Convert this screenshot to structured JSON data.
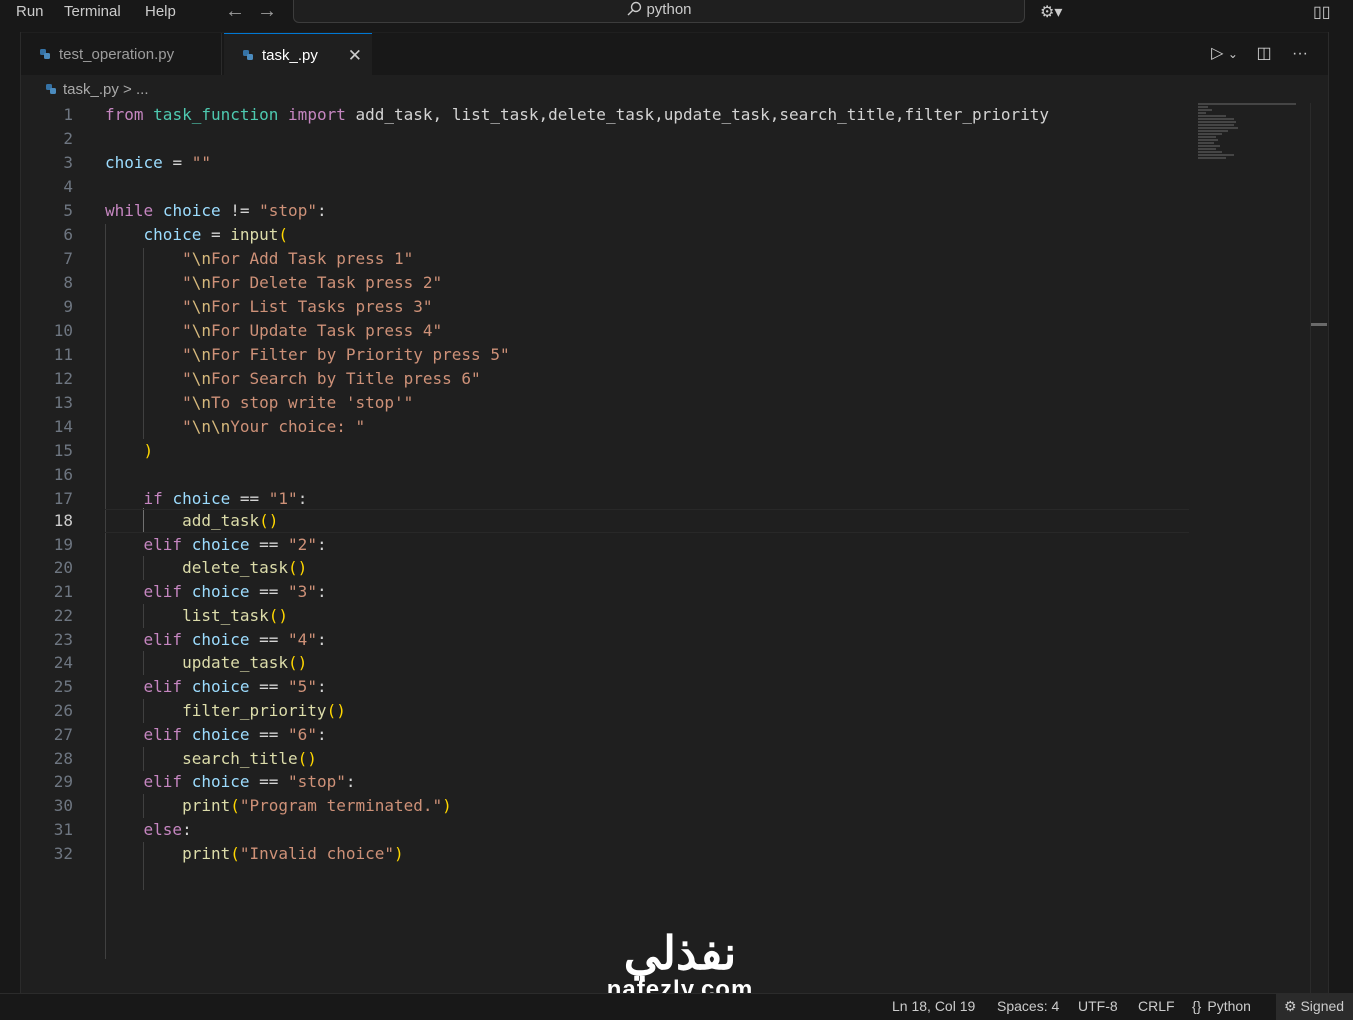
{
  "menu": {
    "run": "Run",
    "terminal": "Terminal",
    "help": "Help"
  },
  "search": {
    "text": "python"
  },
  "tabs": [
    {
      "label": "test_operation.py"
    },
    {
      "label": "task_.py",
      "close": "✕"
    }
  ],
  "breadcrumb": {
    "file": "task_.py",
    "sep": ">",
    "more": "..."
  },
  "editor": {
    "current_line": 18,
    "lines": [
      "1",
      "2",
      "3",
      "4",
      "5",
      "6",
      "7",
      "8",
      "9",
      "10",
      "11",
      "12",
      "13",
      "14",
      "15",
      "16",
      "17",
      "18",
      "19",
      "20",
      "21",
      "22",
      "23",
      "24",
      "25",
      "26",
      "27",
      "28",
      "29",
      "30",
      "31",
      "32"
    ]
  },
  "status": {
    "position": "Ln 18, Col 19",
    "spaces": "Spaces: 4",
    "encoding": "UTF-8",
    "eol": "CRLF",
    "language": "Python",
    "signed": "Signed"
  },
  "watermark": {
    "arabic": "نفذلي",
    "latin": "nafezly.com"
  },
  "colors": {
    "keyword": "#c586c0",
    "function": "#dcdcaa",
    "variable": "#9cdcfe",
    "string": "#ce9178",
    "module": "#4ec9b0",
    "accent": "#0078d4"
  }
}
